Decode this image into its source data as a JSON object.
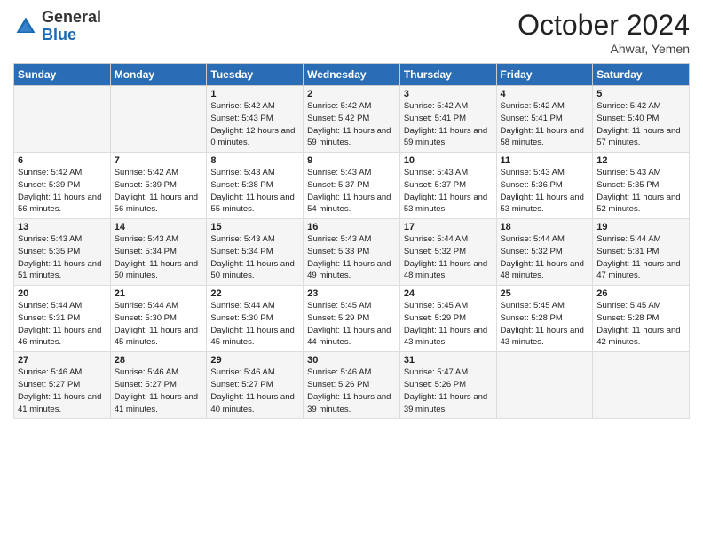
{
  "header": {
    "logo_general": "General",
    "logo_blue": "Blue",
    "month_title": "October 2024",
    "location": "Ahwar, Yemen"
  },
  "days_of_week": [
    "Sunday",
    "Monday",
    "Tuesday",
    "Wednesday",
    "Thursday",
    "Friday",
    "Saturday"
  ],
  "weeks": [
    [
      {
        "day": "",
        "detail": ""
      },
      {
        "day": "",
        "detail": ""
      },
      {
        "day": "1",
        "detail": "Sunrise: 5:42 AM\nSunset: 5:43 PM\nDaylight: 12 hours and 0 minutes."
      },
      {
        "day": "2",
        "detail": "Sunrise: 5:42 AM\nSunset: 5:42 PM\nDaylight: 11 hours and 59 minutes."
      },
      {
        "day": "3",
        "detail": "Sunrise: 5:42 AM\nSunset: 5:41 PM\nDaylight: 11 hours and 59 minutes."
      },
      {
        "day": "4",
        "detail": "Sunrise: 5:42 AM\nSunset: 5:41 PM\nDaylight: 11 hours and 58 minutes."
      },
      {
        "day": "5",
        "detail": "Sunrise: 5:42 AM\nSunset: 5:40 PM\nDaylight: 11 hours and 57 minutes."
      }
    ],
    [
      {
        "day": "6",
        "detail": "Sunrise: 5:42 AM\nSunset: 5:39 PM\nDaylight: 11 hours and 56 minutes."
      },
      {
        "day": "7",
        "detail": "Sunrise: 5:42 AM\nSunset: 5:39 PM\nDaylight: 11 hours and 56 minutes."
      },
      {
        "day": "8",
        "detail": "Sunrise: 5:43 AM\nSunset: 5:38 PM\nDaylight: 11 hours and 55 minutes."
      },
      {
        "day": "9",
        "detail": "Sunrise: 5:43 AM\nSunset: 5:37 PM\nDaylight: 11 hours and 54 minutes."
      },
      {
        "day": "10",
        "detail": "Sunrise: 5:43 AM\nSunset: 5:37 PM\nDaylight: 11 hours and 53 minutes."
      },
      {
        "day": "11",
        "detail": "Sunrise: 5:43 AM\nSunset: 5:36 PM\nDaylight: 11 hours and 53 minutes."
      },
      {
        "day": "12",
        "detail": "Sunrise: 5:43 AM\nSunset: 5:35 PM\nDaylight: 11 hours and 52 minutes."
      }
    ],
    [
      {
        "day": "13",
        "detail": "Sunrise: 5:43 AM\nSunset: 5:35 PM\nDaylight: 11 hours and 51 minutes."
      },
      {
        "day": "14",
        "detail": "Sunrise: 5:43 AM\nSunset: 5:34 PM\nDaylight: 11 hours and 50 minutes."
      },
      {
        "day": "15",
        "detail": "Sunrise: 5:43 AM\nSunset: 5:34 PM\nDaylight: 11 hours and 50 minutes."
      },
      {
        "day": "16",
        "detail": "Sunrise: 5:43 AM\nSunset: 5:33 PM\nDaylight: 11 hours and 49 minutes."
      },
      {
        "day": "17",
        "detail": "Sunrise: 5:44 AM\nSunset: 5:32 PM\nDaylight: 11 hours and 48 minutes."
      },
      {
        "day": "18",
        "detail": "Sunrise: 5:44 AM\nSunset: 5:32 PM\nDaylight: 11 hours and 48 minutes."
      },
      {
        "day": "19",
        "detail": "Sunrise: 5:44 AM\nSunset: 5:31 PM\nDaylight: 11 hours and 47 minutes."
      }
    ],
    [
      {
        "day": "20",
        "detail": "Sunrise: 5:44 AM\nSunset: 5:31 PM\nDaylight: 11 hours and 46 minutes."
      },
      {
        "day": "21",
        "detail": "Sunrise: 5:44 AM\nSunset: 5:30 PM\nDaylight: 11 hours and 45 minutes."
      },
      {
        "day": "22",
        "detail": "Sunrise: 5:44 AM\nSunset: 5:30 PM\nDaylight: 11 hours and 45 minutes."
      },
      {
        "day": "23",
        "detail": "Sunrise: 5:45 AM\nSunset: 5:29 PM\nDaylight: 11 hours and 44 minutes."
      },
      {
        "day": "24",
        "detail": "Sunrise: 5:45 AM\nSunset: 5:29 PM\nDaylight: 11 hours and 43 minutes."
      },
      {
        "day": "25",
        "detail": "Sunrise: 5:45 AM\nSunset: 5:28 PM\nDaylight: 11 hours and 43 minutes."
      },
      {
        "day": "26",
        "detail": "Sunrise: 5:45 AM\nSunset: 5:28 PM\nDaylight: 11 hours and 42 minutes."
      }
    ],
    [
      {
        "day": "27",
        "detail": "Sunrise: 5:46 AM\nSunset: 5:27 PM\nDaylight: 11 hours and 41 minutes."
      },
      {
        "day": "28",
        "detail": "Sunrise: 5:46 AM\nSunset: 5:27 PM\nDaylight: 11 hours and 41 minutes."
      },
      {
        "day": "29",
        "detail": "Sunrise: 5:46 AM\nSunset: 5:27 PM\nDaylight: 11 hours and 40 minutes."
      },
      {
        "day": "30",
        "detail": "Sunrise: 5:46 AM\nSunset: 5:26 PM\nDaylight: 11 hours and 39 minutes."
      },
      {
        "day": "31",
        "detail": "Sunrise: 5:47 AM\nSunset: 5:26 PM\nDaylight: 11 hours and 39 minutes."
      },
      {
        "day": "",
        "detail": ""
      },
      {
        "day": "",
        "detail": ""
      }
    ]
  ]
}
